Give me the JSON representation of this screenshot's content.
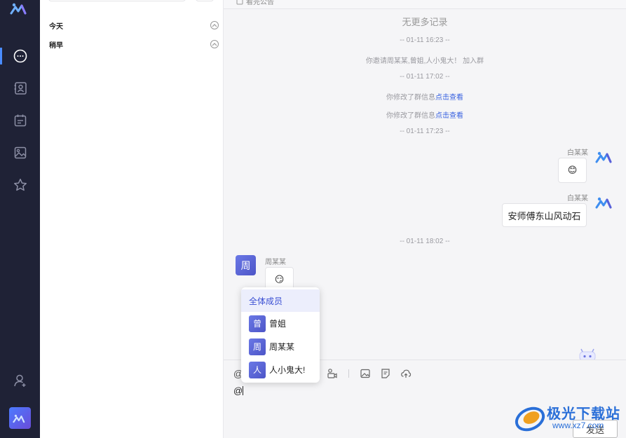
{
  "sidebar": {
    "nav": [
      "chat-icon",
      "contacts-icon",
      "calendar-icon",
      "album-icon",
      "star-icon"
    ],
    "bottom": [
      "add-friend-icon",
      "user-avatar"
    ]
  },
  "conv_list": {
    "groups": [
      {
        "label": "今天"
      },
      {
        "label": "稍早"
      }
    ]
  },
  "chat": {
    "top_label": "看完公告",
    "no_more": "无更多记录",
    "timestamps": [
      "-- 01-11 16:23 --",
      "-- 01-11 17:02 --",
      "-- 01-11 17:23 --",
      "-- 01-11 18:02 --"
    ],
    "sys_invite": "你邀请周某某,曾姐,人小鬼大！ 加入群",
    "sys_modified": "你修改了群信息",
    "sys_link": "点击查看",
    "msg1_sender": "白某某",
    "msg1_emoji": "😊",
    "msg2_sender": "白某某",
    "msg2_text": "安师傅东山风动石",
    "msg3_sender": "周某某",
    "msg3_avatar": "周",
    "msg3_emoji": "😏"
  },
  "input": {
    "text": "@",
    "at_icon": "@",
    "send_label": "发送"
  },
  "mention_popup": {
    "all_label": "全体成员",
    "members": [
      {
        "avatar": "曾",
        "name": "曾姐"
      },
      {
        "avatar": "周",
        "name": "周某某"
      },
      {
        "avatar": "人",
        "name": "人小鬼大!"
      }
    ]
  },
  "watermark": {
    "line1": "极光下载站",
    "line2": "www.xz7.com"
  },
  "colors": {
    "rail_bg": "#1f2236",
    "accent": "#3a63e0",
    "chat_bg": "#f5f5f7"
  }
}
